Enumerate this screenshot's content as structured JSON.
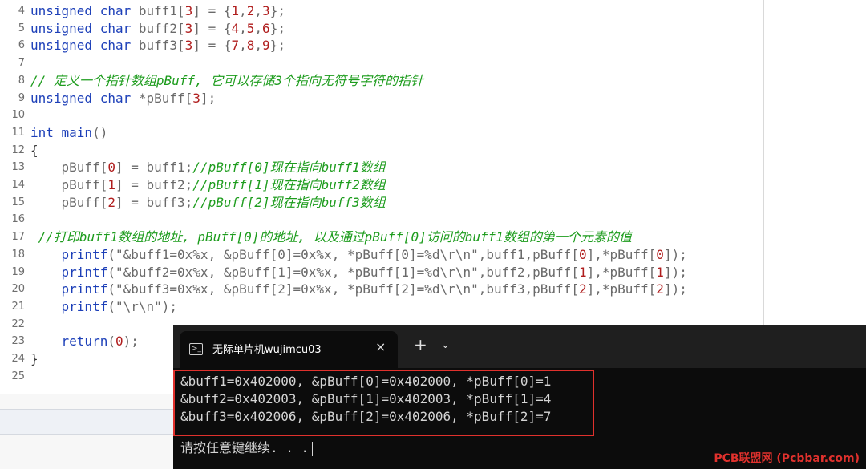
{
  "editor": {
    "lines": [
      {
        "n": "4",
        "parts": [
          [
            "kw",
            "unsigned char"
          ],
          [
            "plain",
            " buff1["
          ],
          [
            "num",
            "3"
          ],
          [
            "plain",
            "] = {"
          ],
          [
            "num",
            "1"
          ],
          [
            "plain",
            ","
          ],
          [
            "num",
            "2"
          ],
          [
            "plain",
            ","
          ],
          [
            "num",
            "3"
          ],
          [
            "plain",
            "};"
          ]
        ]
      },
      {
        "n": "5",
        "parts": [
          [
            "kw",
            "unsigned char"
          ],
          [
            "plain",
            " buff2["
          ],
          [
            "num",
            "3"
          ],
          [
            "plain",
            "] = {"
          ],
          [
            "num",
            "4"
          ],
          [
            "plain",
            ","
          ],
          [
            "num",
            "5"
          ],
          [
            "plain",
            ","
          ],
          [
            "num",
            "6"
          ],
          [
            "plain",
            "};"
          ]
        ]
      },
      {
        "n": "6",
        "parts": [
          [
            "kw",
            "unsigned char"
          ],
          [
            "plain",
            " buff3["
          ],
          [
            "num",
            "3"
          ],
          [
            "plain",
            "] = {"
          ],
          [
            "num",
            "7"
          ],
          [
            "plain",
            ","
          ],
          [
            "num",
            "8"
          ],
          [
            "plain",
            ","
          ],
          [
            "num",
            "9"
          ],
          [
            "plain",
            "};"
          ]
        ]
      },
      {
        "n": "7",
        "parts": []
      },
      {
        "n": "8",
        "parts": [
          [
            "cm",
            "// 定义一个指针数组pBuff, 它可以存储3个指向无符号字符的指针"
          ]
        ]
      },
      {
        "n": "9",
        "parts": [
          [
            "kw",
            "unsigned char"
          ],
          [
            "plain",
            " *pBuff["
          ],
          [
            "num",
            "3"
          ],
          [
            "plain",
            "];"
          ]
        ]
      },
      {
        "n": "10",
        "parts": []
      },
      {
        "n": "11",
        "parts": [
          [
            "kw",
            "int main"
          ],
          [
            "plain",
            "()"
          ]
        ]
      },
      {
        "n": "12",
        "parts": [
          [
            "dark",
            "{"
          ]
        ]
      },
      {
        "n": "13",
        "parts": [
          [
            "plain",
            "    pBuff["
          ],
          [
            "num",
            "0"
          ],
          [
            "plain",
            "] = buff1;"
          ],
          [
            "cm",
            "//pBuff[0]现在指向buff1数组"
          ]
        ]
      },
      {
        "n": "14",
        "parts": [
          [
            "plain",
            "    pBuff["
          ],
          [
            "num",
            "1"
          ],
          [
            "plain",
            "] = buff2;"
          ],
          [
            "cm",
            "//pBuff[1]现在指向buff2数组"
          ]
        ]
      },
      {
        "n": "15",
        "parts": [
          [
            "plain",
            "    pBuff["
          ],
          [
            "num",
            "2"
          ],
          [
            "plain",
            "] = buff3;"
          ],
          [
            "cm",
            "//pBuff[2]现在指向buff3数组"
          ]
        ]
      },
      {
        "n": "16",
        "parts": []
      },
      {
        "n": "17",
        "parts": [
          [
            "cm",
            " //打印buff1数组的地址, pBuff[0]的地址, 以及通过pBuff[0]访问的buff1数组的第一个元素的值"
          ]
        ]
      },
      {
        "n": "18",
        "parts": [
          [
            "plain",
            "    "
          ],
          [
            "kw",
            "printf"
          ],
          [
            "plain",
            "("
          ],
          [
            "str",
            "\"&buff1=0x%x, &pBuff[0]=0x%x, *pBuff[0]=%d\\r\\n\""
          ],
          [
            "plain",
            ",buff1,pBuff["
          ],
          [
            "num",
            "0"
          ],
          [
            "plain",
            "],*pBuff["
          ],
          [
            "num",
            "0"
          ],
          [
            "plain",
            "]);"
          ]
        ]
      },
      {
        "n": "19",
        "parts": [
          [
            "plain",
            "    "
          ],
          [
            "kw",
            "printf"
          ],
          [
            "plain",
            "("
          ],
          [
            "str",
            "\"&buff2=0x%x, &pBuff[1]=0x%x, *pBuff[1]=%d\\r\\n\""
          ],
          [
            "plain",
            ",buff2,pBuff["
          ],
          [
            "num",
            "1"
          ],
          [
            "plain",
            "],*pBuff["
          ],
          [
            "num",
            "1"
          ],
          [
            "plain",
            "]);"
          ]
        ]
      },
      {
        "n": "20",
        "parts": [
          [
            "plain",
            "    "
          ],
          [
            "kw",
            "printf"
          ],
          [
            "plain",
            "("
          ],
          [
            "str",
            "\"&buff3=0x%x, &pBuff[2]=0x%x, *pBuff[2]=%d\\r\\n\""
          ],
          [
            "plain",
            ",buff3,pBuff["
          ],
          [
            "num",
            "2"
          ],
          [
            "plain",
            "],*pBuff["
          ],
          [
            "num",
            "2"
          ],
          [
            "plain",
            "]);"
          ]
        ]
      },
      {
        "n": "21",
        "parts": [
          [
            "plain",
            "    "
          ],
          [
            "kw",
            "printf"
          ],
          [
            "plain",
            "("
          ],
          [
            "str",
            "\"\\r\\n\""
          ],
          [
            "plain",
            ");"
          ]
        ]
      },
      {
        "n": "22",
        "parts": []
      },
      {
        "n": "23",
        "parts": [
          [
            "plain",
            "    "
          ],
          [
            "kw",
            "return"
          ],
          [
            "plain",
            "("
          ],
          [
            "num",
            "0"
          ],
          [
            "plain",
            ");"
          ]
        ]
      },
      {
        "n": "24",
        "parts": [
          [
            "dark",
            "}"
          ]
        ]
      },
      {
        "n": "25",
        "parts": []
      }
    ]
  },
  "terminal": {
    "tab_title": "无际单片机wujimcu03",
    "close_icon": "×",
    "new_tab_icon": "+",
    "dropdown_icon": "⌄",
    "output": [
      "&buff1=0x402000, &pBuff[0]=0x402000, *pBuff[0]=1",
      "&buff2=0x402003, &pBuff[1]=0x402003, *pBuff[1]=4",
      "&buff3=0x402006, &pBuff[2]=0x402006, *pBuff[2]=7"
    ],
    "prompt": "请按任意键继续. . ."
  },
  "watermark": "PCB联盟网 (Pcbbar.com)",
  "colors": {
    "keyword": "#1c3fb8",
    "number": "#b01e1e",
    "comment": "#1d9c1d",
    "highlight_box": "#e0312d",
    "terminal_bg": "#0c0c0c"
  }
}
